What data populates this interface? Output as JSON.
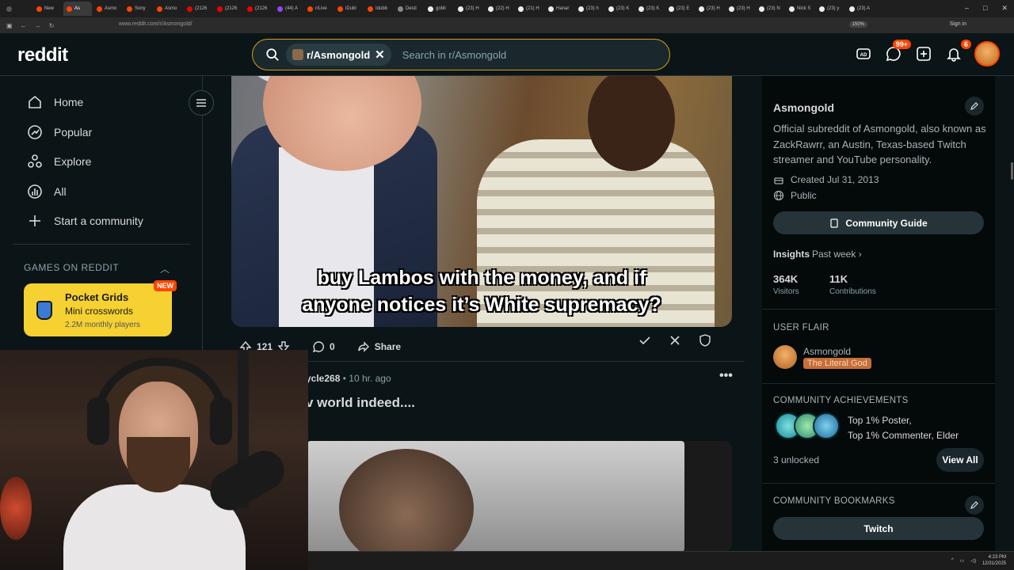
{
  "browser": {
    "tabs": [
      {
        "label": "",
        "color": "#555"
      },
      {
        "label": "New",
        "color": "#ff4500"
      },
      {
        "label": "As",
        "color": "#ff4500",
        "active": true
      },
      {
        "label": "Asmo",
        "color": "#ff4500"
      },
      {
        "label": "Sony",
        "color": "#ff4500"
      },
      {
        "label": "Asmo",
        "color": "#ff4500"
      },
      {
        "label": "(2126",
        "color": "#e00"
      },
      {
        "label": "(2126",
        "color": "#e00"
      },
      {
        "label": "(2126",
        "color": "#e00"
      },
      {
        "label": "(44) A",
        "color": "#9147ff"
      },
      {
        "label": "r/Live",
        "color": "#ff4500"
      },
      {
        "label": "iDubl",
        "color": "#ff4500"
      },
      {
        "label": "Idubb",
        "color": "#ff4500"
      },
      {
        "label": "Desti",
        "color": "#888"
      },
      {
        "label": "gobli",
        "color": "#eee"
      },
      {
        "label": "(23) H",
        "color": "#eee"
      },
      {
        "label": "(22) H",
        "color": "#eee"
      },
      {
        "label": "(21) H",
        "color": "#eee"
      },
      {
        "label": "Hanar",
        "color": "#eee"
      },
      {
        "label": "(23) h",
        "color": "#eee"
      },
      {
        "label": "(23) K",
        "color": "#eee"
      },
      {
        "label": "(23) K",
        "color": "#eee"
      },
      {
        "label": "(23) E",
        "color": "#eee"
      },
      {
        "label": "(23) H",
        "color": "#eee"
      },
      {
        "label": "(23) H",
        "color": "#eee"
      },
      {
        "label": "(23) N",
        "color": "#eee"
      },
      {
        "label": "Nick S",
        "color": "#eee"
      },
      {
        "label": "(23) y",
        "color": "#eee"
      },
      {
        "label": "(23) A",
        "color": "#eee"
      }
    ],
    "url": "www.reddit.com/r/Asmongold/",
    "zoom": "150%",
    "signin": "Sign in"
  },
  "header": {
    "logo": "reddit",
    "search_chip": "r/Asmongold",
    "search_placeholder": "Search in r/Asmongold",
    "chat_badge": "99+",
    "notif_badge": "6"
  },
  "leftnav": {
    "items": [
      {
        "label": "Home"
      },
      {
        "label": "Popular"
      },
      {
        "label": "Explore"
      },
      {
        "label": "All"
      },
      {
        "label": "Start a community"
      }
    ],
    "games_header": "GAMES ON REDDIT",
    "game": {
      "title": "Pocket Grids",
      "subtitle": "Mini crosswords",
      "players": "2.2M monthly players",
      "badge": "NEW"
    }
  },
  "post1": {
    "caption_line1": "buy Lambos with the money, and if",
    "caption_line2": "anyone notices it’s White supremacy?",
    "upvotes": "121",
    "comments": "0",
    "share": "Share"
  },
  "post2": {
    "author": "ycle268",
    "time": "• 10 hr. ago",
    "title": "v world indeed...."
  },
  "sidebar": {
    "name": "Asmongold",
    "description": "Official subreddit of Asmongold, also known as ZackRawrr, an Austin, Texas-based Twitch streamer and YouTube personality.",
    "created": "Created Jul 31, 2013",
    "visibility": "Public",
    "guide_button": "Community Guide",
    "insights_label": "Insights",
    "insights_range": "Past week",
    "visitors_value": "364K",
    "visitors_label": "Visitors",
    "contrib_value": "11K",
    "contrib_label": "Contributions",
    "user_flair_header": "USER FLAIR",
    "flair_name": "Asmongold",
    "flair_tag": "The Literal God",
    "achievements_header": "COMMUNITY ACHIEVEMENTS",
    "achievements_line1": "Top 1% Poster,",
    "achievements_line2": "Top 1% Commenter, Elder",
    "unlocked": "3 unlocked",
    "view_all": "View All",
    "bookmarks_header": "COMMUNITY BOOKMARKS",
    "bookmark1": "Twitch"
  },
  "taskbar": {
    "time": "4:23 PM",
    "date": "12/31/2025"
  }
}
